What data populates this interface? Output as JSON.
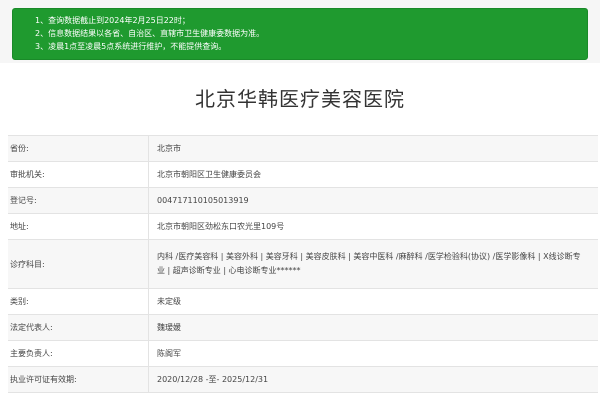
{
  "notice": {
    "lines": [
      "1、查询数据截止到2024年2月25日22时；",
      "2、信息数据结果以各省、自治区、直辖市卫生健康委数据为准。",
      "3、凌晨1点至凌晨5点系统进行维护，不能提供查询。"
    ],
    "background_color": "#1f9a2f"
  },
  "card": {
    "title": "北京华韩医疗美容医院"
  },
  "table": {
    "rows": [
      {
        "label": "省份:",
        "value": "北京市"
      },
      {
        "label": "审批机关:",
        "value": "北京市朝阳区卫生健康委员会"
      },
      {
        "label": "登记号:",
        "value": "004717110105013919"
      },
      {
        "label": "地址:",
        "value": "北京市朝阳区劲松东口农光里109号"
      },
      {
        "label": "诊疗科目:",
        "value": "内科 /医疗美容科 | 美容外科 | 美容牙科 | 美容皮肤科 | 美容中医科 /麻醉科 /医学检验科(协议) /医学影像科 | X线诊断专业 | 超声诊断专业 | 心电诊断专业******"
      },
      {
        "label": "类别:",
        "value": "未定级"
      },
      {
        "label": "法定代表人:",
        "value": "魏瑷媛"
      },
      {
        "label": "主要负责人:",
        "value": "陈阁军"
      },
      {
        "label": "执业许可证有效期:",
        "value": "2020/12/28 -至- 2025/12/31"
      }
    ]
  }
}
